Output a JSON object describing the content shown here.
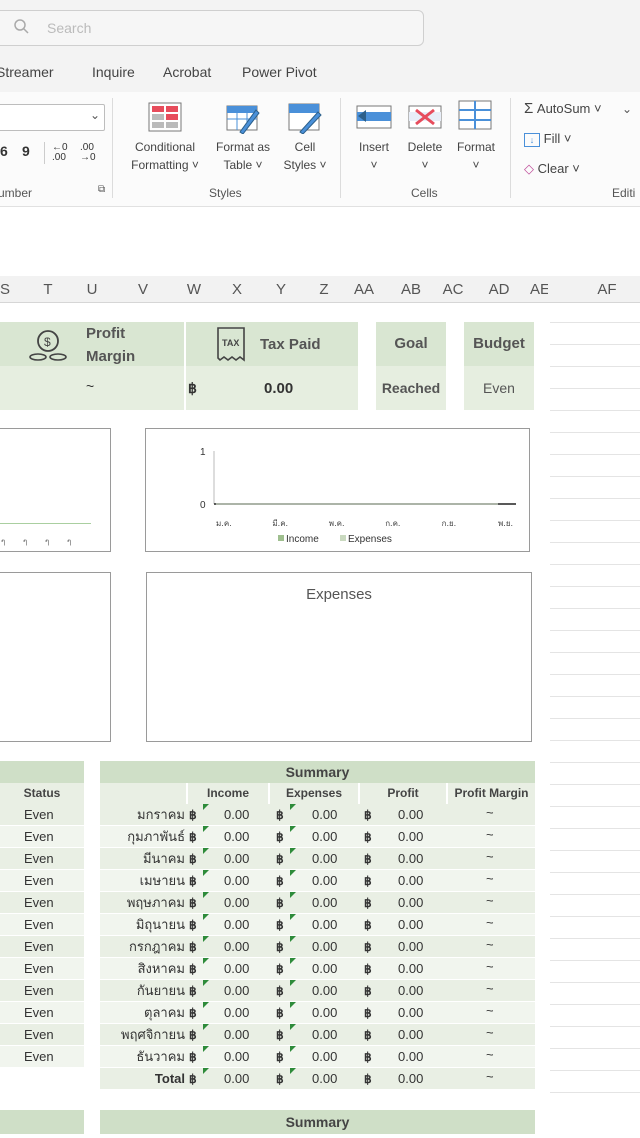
{
  "search": {
    "placeholder": "Search"
  },
  "tabs": [
    "Streamer",
    "Inquire",
    "Acrobat",
    "Power Pivot"
  ],
  "ribbon": {
    "number_group": "umber",
    "number_icons": [
      "6",
      "9",
      "←0 .00",
      ".00 →0"
    ],
    "styles": {
      "conditional": [
        "Conditional",
        "Formatting ˅"
      ],
      "format_table": [
        "Format as",
        "Table ˅"
      ],
      "cell_styles": [
        "Cell",
        "Styles ˅"
      ],
      "group": "Styles"
    },
    "cells": {
      "insert": "Insert",
      "delete": "Delete",
      "format": "Format",
      "group": "Cells"
    },
    "editing": {
      "autosum": "AutoSum ˅",
      "fill": "Fill ˅",
      "clear": "Clear ˅",
      "group": "Editi"
    }
  },
  "columns": [
    "S",
    "T",
    "U",
    "V",
    "W",
    "X",
    "Y",
    "Z",
    "AA",
    "AB",
    "AC",
    "AD",
    "AE",
    "AF"
  ],
  "cards": {
    "profit_margin": {
      "title1": "Profit",
      "title2": "Margin",
      "value": "~"
    },
    "tax_paid": {
      "title": "Tax Paid",
      "currency": "฿",
      "value": "0.00"
    },
    "goal": {
      "title": "Goal",
      "value": "Reached"
    },
    "budget": {
      "title": "Budget",
      "value": "Even"
    }
  },
  "chart_data": [
    {
      "type": "line",
      "title": "",
      "categories": [
        "ม.ค.",
        "มี.ค.",
        "พ.ค.",
        "ก.ค.",
        "ก.ย.",
        "พ.ย."
      ],
      "series": [
        {
          "name": "Income",
          "values": [
            0,
            0,
            0,
            0,
            0,
            0
          ]
        },
        {
          "name": "Expenses",
          "values": [
            0,
            0,
            0,
            0,
            0,
            0
          ]
        }
      ],
      "ylim": [
        0,
        1
      ],
      "yticks": [
        "1",
        "0"
      ],
      "legend": "bottom"
    },
    {
      "type": "pie",
      "title": "Expenses",
      "values": []
    }
  ],
  "status_table": {
    "header": "Status",
    "values": [
      "Even",
      "Even",
      "Even",
      "Even",
      "Even",
      "Even",
      "Even",
      "Even",
      "Even",
      "Even",
      "Even",
      "Even"
    ]
  },
  "summary": {
    "title": "Summary",
    "columns": [
      "Income",
      "Expenses",
      "Profit",
      "Profit Margin"
    ],
    "rows": [
      {
        "month": "มกราคม",
        "income": "0.00",
        "expenses": "0.00",
        "profit": "0.00",
        "margin": "~"
      },
      {
        "month": "กุมภาพันธ์",
        "income": "0.00",
        "expenses": "0.00",
        "profit": "0.00",
        "margin": "~"
      },
      {
        "month": "มีนาคม",
        "income": "0.00",
        "expenses": "0.00",
        "profit": "0.00",
        "margin": "~"
      },
      {
        "month": "เมษายน",
        "income": "0.00",
        "expenses": "0.00",
        "profit": "0.00",
        "margin": "~"
      },
      {
        "month": "พฤษภาคม",
        "income": "0.00",
        "expenses": "0.00",
        "profit": "0.00",
        "margin": "~"
      },
      {
        "month": "มิถุนายน",
        "income": "0.00",
        "expenses": "0.00",
        "profit": "0.00",
        "margin": "~"
      },
      {
        "month": "กรกฎาคม",
        "income": "0.00",
        "expenses": "0.00",
        "profit": "0.00",
        "margin": "~"
      },
      {
        "month": "สิงหาคม",
        "income": "0.00",
        "expenses": "0.00",
        "profit": "0.00",
        "margin": "~"
      },
      {
        "month": "กันยายน",
        "income": "0.00",
        "expenses": "0.00",
        "profit": "0.00",
        "margin": "~"
      },
      {
        "month": "ตุลาคม",
        "income": "0.00",
        "expenses": "0.00",
        "profit": "0.00",
        "margin": "~"
      },
      {
        "month": "พฤศจิกายน",
        "income": "0.00",
        "expenses": "0.00",
        "profit": "0.00",
        "margin": "~"
      },
      {
        "month": "ธันวาคม",
        "income": "0.00",
        "expenses": "0.00",
        "profit": "0.00",
        "margin": "~"
      },
      {
        "month": "Total",
        "income": "0.00",
        "expenses": "0.00",
        "profit": "0.00",
        "margin": "~"
      }
    ],
    "currency": "฿",
    "bottom_title": "Summary"
  },
  "colors": {
    "card_green": "#d9e6d2",
    "header_green": "#cfdfc7",
    "row_green": "#e9efe4",
    "flag_green": "#2e8b3a"
  }
}
